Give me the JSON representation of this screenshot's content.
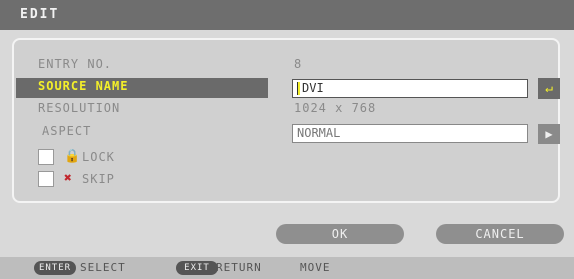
{
  "title": "EDIT",
  "fields": {
    "entry_no_label": "ENTRY NO.",
    "entry_no_value": "8",
    "source_name_label": "SOURCE NAME",
    "source_name_value": "DVI",
    "resolution_label": "RESOLUTION",
    "resolution_value": "1024 x 768",
    "aspect_label": "ASPECT",
    "aspect_value": "NORMAL",
    "enter_icon": "enter-icon",
    "dropdown_icon": "dropdown-arrow-icon"
  },
  "checks": [
    {
      "label": "LOCK",
      "icon": "lock-icon",
      "checked": false
    },
    {
      "label": "SKIP",
      "icon": "skip-icon",
      "checked": false
    }
  ],
  "buttons": {
    "ok": "OK",
    "cancel": "CANCEL"
  },
  "footer": {
    "select_key": "ENTER",
    "select_label": "SELECT",
    "return_key": "EXIT",
    "return_label": "RETURN",
    "move_label": "MOVE"
  },
  "colors": {
    "highlight_text": "#f3ef2a",
    "titlebar": "#6e6e6e",
    "button": "#8f8f8f"
  }
}
